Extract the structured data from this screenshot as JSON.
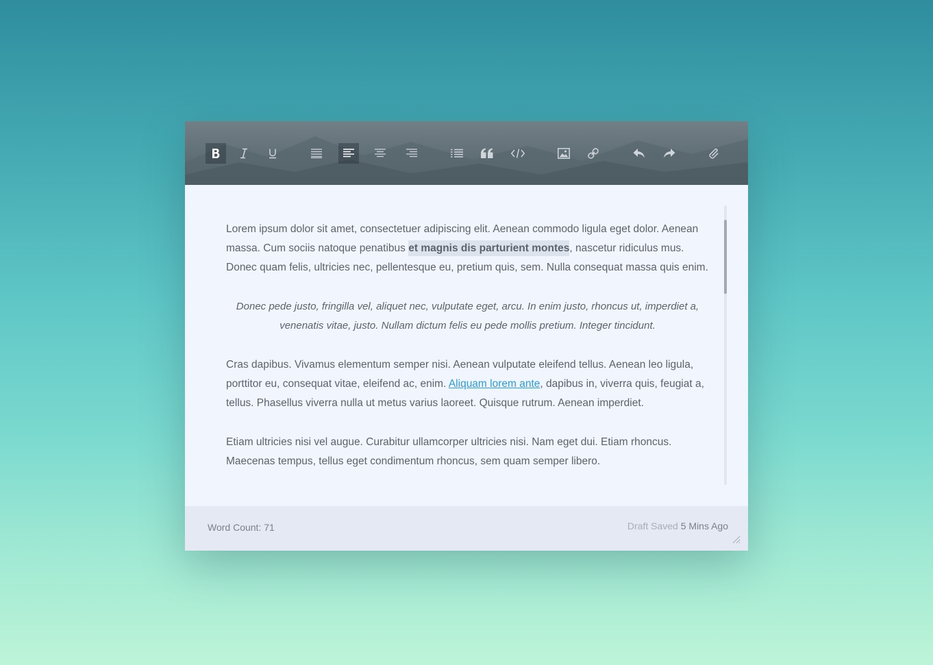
{
  "toolbar": {
    "buttons": [
      {
        "name": "bold-button",
        "icon": "bold-icon",
        "active": true
      },
      {
        "name": "italic-button",
        "icon": "italic-icon",
        "active": false
      },
      {
        "name": "underline-button",
        "icon": "underline-icon",
        "active": false
      },
      {
        "name": "justify-button",
        "icon": "align-justify-icon",
        "active": false
      },
      {
        "name": "align-left-button",
        "icon": "align-left-icon",
        "active": true
      },
      {
        "name": "align-center-button",
        "icon": "align-center-icon",
        "active": false
      },
      {
        "name": "align-right-button",
        "icon": "align-right-icon",
        "active": false
      },
      {
        "name": "bullet-list-button",
        "icon": "list-icon",
        "active": false
      },
      {
        "name": "blockquote-button",
        "icon": "quote-icon",
        "active": false
      },
      {
        "name": "code-button",
        "icon": "code-icon",
        "active": false
      },
      {
        "name": "insert-image-button",
        "icon": "image-icon",
        "active": false
      },
      {
        "name": "insert-link-button",
        "icon": "link-icon",
        "active": false
      },
      {
        "name": "undo-button",
        "icon": "undo-icon",
        "active": false
      },
      {
        "name": "redo-button",
        "icon": "redo-icon",
        "active": false
      },
      {
        "name": "attach-button",
        "icon": "paperclip-icon",
        "active": false
      }
    ]
  },
  "content": {
    "p1_before": "Lorem ipsum dolor sit amet, consectetuer adipiscing elit. Aenean commodo ligula eget dolor. Aenean massa. Cum sociis natoque penatibus ",
    "p1_highlight": "et magnis dis parturient montes",
    "p1_after": ", nascetur ridiculus mus. Donec quam felis, ultricies nec, pellentesque eu, pretium quis, sem. Nulla consequat massa quis enim.",
    "quote": "Donec pede justo, fringilla vel, aliquet nec, vulputate eget, arcu. In enim justo, rhoncus ut, imperdiet a, venenatis vitae, justo. Nullam dictum felis eu pede mollis pretium. Integer tincidunt.",
    "p3_before": "Cras dapibus. Vivamus elementum semper nisi. Aenean vulputate eleifend tellus. Aenean leo ligula, porttitor eu, consequat vitae, eleifend ac, enim. ",
    "p3_link": "Aliquam lorem ante",
    "p3_after": ", dapibus in, viverra quis, feugiat a, tellus. Phasellus viverra nulla ut metus varius laoreet. Quisque rutrum. Aenean imperdiet.",
    "p4": "Etiam ultricies nisi vel augue. Curabitur ullamcorper ultricies nisi. Nam eget dui. Etiam rhoncus. Maecenas tempus, tellus eget condimentum rhoncus, sem quam semper libero."
  },
  "footer": {
    "word_count": "Word Count: 71",
    "draft_label": "Draft Saved",
    "draft_time": "5 Mins Ago"
  },
  "colors": {
    "link": "#2a9bdb",
    "toolbar_bg": "#606e75",
    "editor_bg": "#f1f5fd",
    "footer_bg": "#e5e9f4"
  }
}
